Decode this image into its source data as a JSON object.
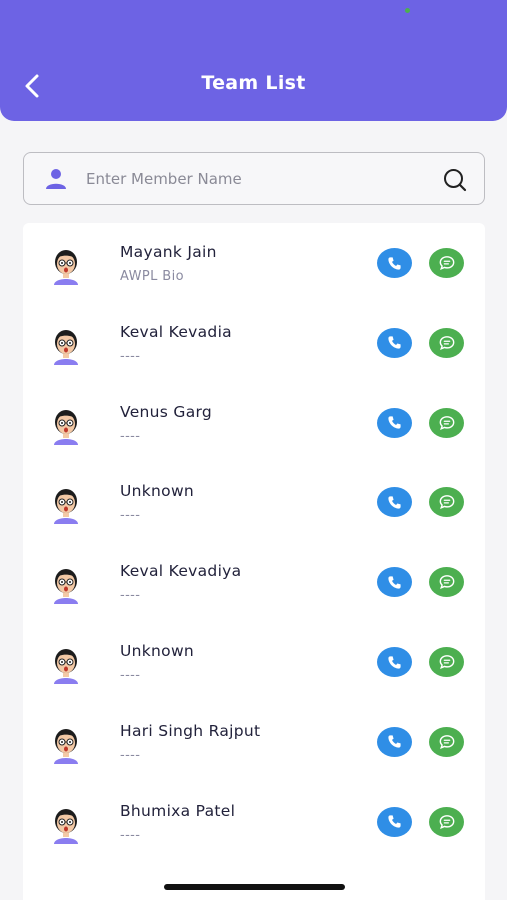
{
  "header": {
    "title": "Team List",
    "accent_color": "#6d63e4"
  },
  "search": {
    "placeholder": "Enter Member Name",
    "value": ""
  },
  "icons": {
    "back": "chevron-left-icon",
    "person": "person-icon",
    "search": "search-icon",
    "call": "phone-icon",
    "chat": "chat-bubble-icon",
    "avatar": "avatar-girl-icon"
  },
  "colors": {
    "call": "#2f8ee6",
    "chat": "#4caf50"
  },
  "members": [
    {
      "name": "Mayank Jain",
      "sub": "AWPL Bio"
    },
    {
      "name": "Keval Kevadia",
      "sub": "----"
    },
    {
      "name": "Venus Garg",
      "sub": "----"
    },
    {
      "name": "Unknown",
      "sub": "----"
    },
    {
      "name": "Keval Kevadiya",
      "sub": "----"
    },
    {
      "name": "Unknown",
      "sub": "----"
    },
    {
      "name": "Hari Singh Rajput",
      "sub": "----"
    },
    {
      "name": "Bhumixa Patel",
      "sub": "----"
    }
  ]
}
